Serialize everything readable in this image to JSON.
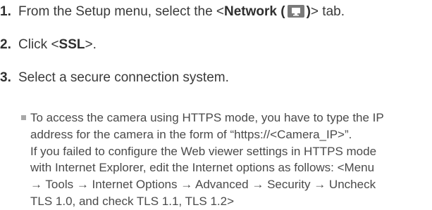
{
  "steps": [
    {
      "number": "1.",
      "text_before": "From the Setup menu, select the <",
      "bold_text": "Network (",
      "icon": "network-monitor-icon",
      "bold_close": ")",
      "text_after": "> tab."
    },
    {
      "number": "2.",
      "text_before": "Click <",
      "bold_text": "SSL",
      "text_after": ">."
    },
    {
      "number": "3.",
      "text": "Select a secure connection system."
    }
  ],
  "note": {
    "lines": [
      "To access the camera using HTTPS mode, you have to type the IP",
      "address for the camera in the form of “https://<Camera_IP>”.",
      "If you failed to configure the Web viewer settings in HTTPS mode",
      "with Internet Explorer, edit the Internet options as follows: <Menu",
      "→ Tools → Internet Options → Advanced → Security → Uncheck",
      "TLS 1.0, and check TLS 1.1, TLS 1.2>"
    ]
  }
}
